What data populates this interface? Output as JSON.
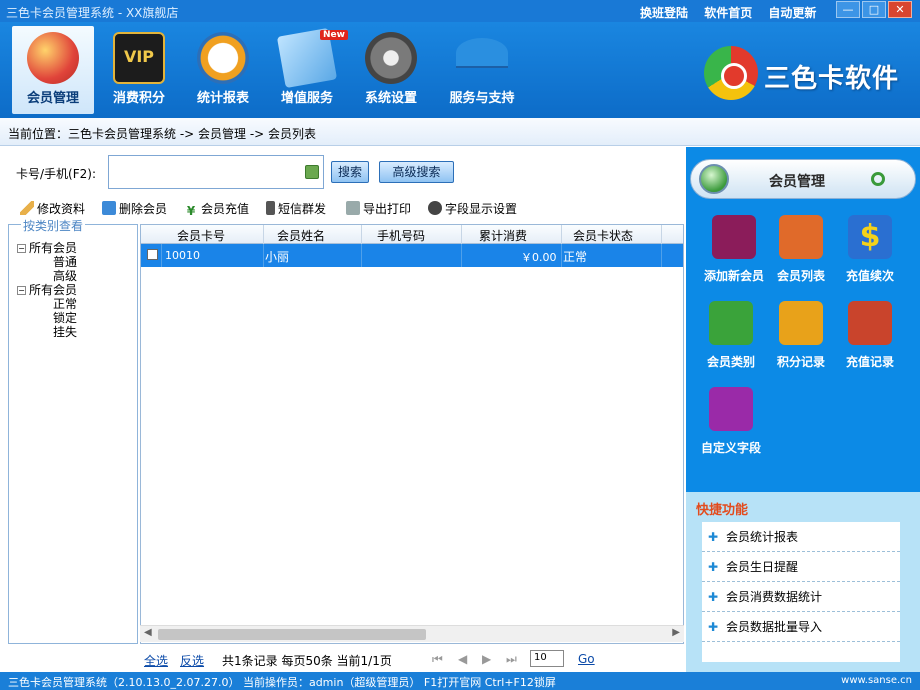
{
  "window": {
    "title": "三色卡会员管理系统 - XX旗舰店",
    "top_links": [
      "换班登陆",
      "软件首页",
      "自动更新"
    ],
    "controls": [
      "—",
      "□",
      "✕"
    ]
  },
  "toolbar": {
    "items": [
      {
        "label": "会员管理",
        "active": true,
        "icon": "members-icon"
      },
      {
        "label": "消费积分",
        "active": false,
        "icon": "vip-icon"
      },
      {
        "label": "统计报表",
        "active": false,
        "icon": "clock-icon"
      },
      {
        "label": "增值服务",
        "active": false,
        "icon": "card-icon",
        "badge": "New"
      },
      {
        "label": "系统设置",
        "active": false,
        "icon": "gear-icon"
      },
      {
        "label": "服务与支持",
        "active": false,
        "icon": "umbrella-icon"
      }
    ],
    "logo_text": "三色卡软件"
  },
  "breadcrumb": "当前位置：三色卡会员管理系统 -> 会员管理 -> 会员列表",
  "search": {
    "label": "卡号/手机(F2):",
    "value": "",
    "search_button": "搜索",
    "advanced_button": "高级搜索"
  },
  "actions": [
    {
      "label": "修改资料",
      "icon": "pencil-icon"
    },
    {
      "label": "删除会员",
      "icon": "delete-icon"
    },
    {
      "label": "会员充值",
      "icon": "yen-icon"
    },
    {
      "label": "短信群发",
      "icon": "phone-icon"
    },
    {
      "label": "导出打印",
      "icon": "printer-icon"
    },
    {
      "label": "字段显示设置",
      "icon": "settings-icon"
    }
  ],
  "tree": {
    "title": "按类别查看",
    "groups": [
      {
        "label": "所有会员",
        "children": [
          "普通",
          "高级"
        ]
      },
      {
        "label": "所有会员",
        "children": [
          "正常",
          "锁定",
          "挂失"
        ]
      }
    ]
  },
  "grid": {
    "columns": [
      "会员卡号",
      "会员姓名",
      "手机号码",
      "累计消费",
      "会员卡状态"
    ],
    "rows": [
      {
        "card": "10010",
        "name": "小丽",
        "phone": "",
        "total": "￥0.00",
        "status": "正常"
      }
    ]
  },
  "pager": {
    "select_all": "全选",
    "invert": "反选",
    "summary": "共1条记录 每页50条 当前1/1页",
    "page_value": "10",
    "go": "Go"
  },
  "right_panel": {
    "title": "会员管理",
    "tiles": [
      {
        "label": "添加新会员",
        "icon": "add-member-icon",
        "color": "#8b1c5a"
      },
      {
        "label": "会员列表",
        "icon": "member-list-icon",
        "color": "#e06a2a"
      },
      {
        "label": "充值续次",
        "icon": "dollar-icon",
        "color": "#2a6fd1"
      },
      {
        "label": "会员类别",
        "icon": "category-icon",
        "color": "#3aa33a"
      },
      {
        "label": "积分记录",
        "icon": "truck-icon",
        "color": "#e8a21a"
      },
      {
        "label": "充值记录",
        "icon": "record-icon",
        "color": "#c9442c"
      },
      {
        "label": "自定义字段",
        "icon": "custom-field-icon",
        "color": "#9a2aa8"
      }
    ]
  },
  "quick": {
    "title": "快捷功能",
    "items": [
      "会员统计报表",
      "会员生日提醒",
      "会员消费数据统计",
      "会员数据批量导入"
    ]
  },
  "status": {
    "text": "三色卡会员管理系统（2.10.13.0_2.07.27.0） 当前操作员：admin（超级管理员） F1打开官网 Ctrl+F12锁屏",
    "url": "www.sanse.cn"
  }
}
